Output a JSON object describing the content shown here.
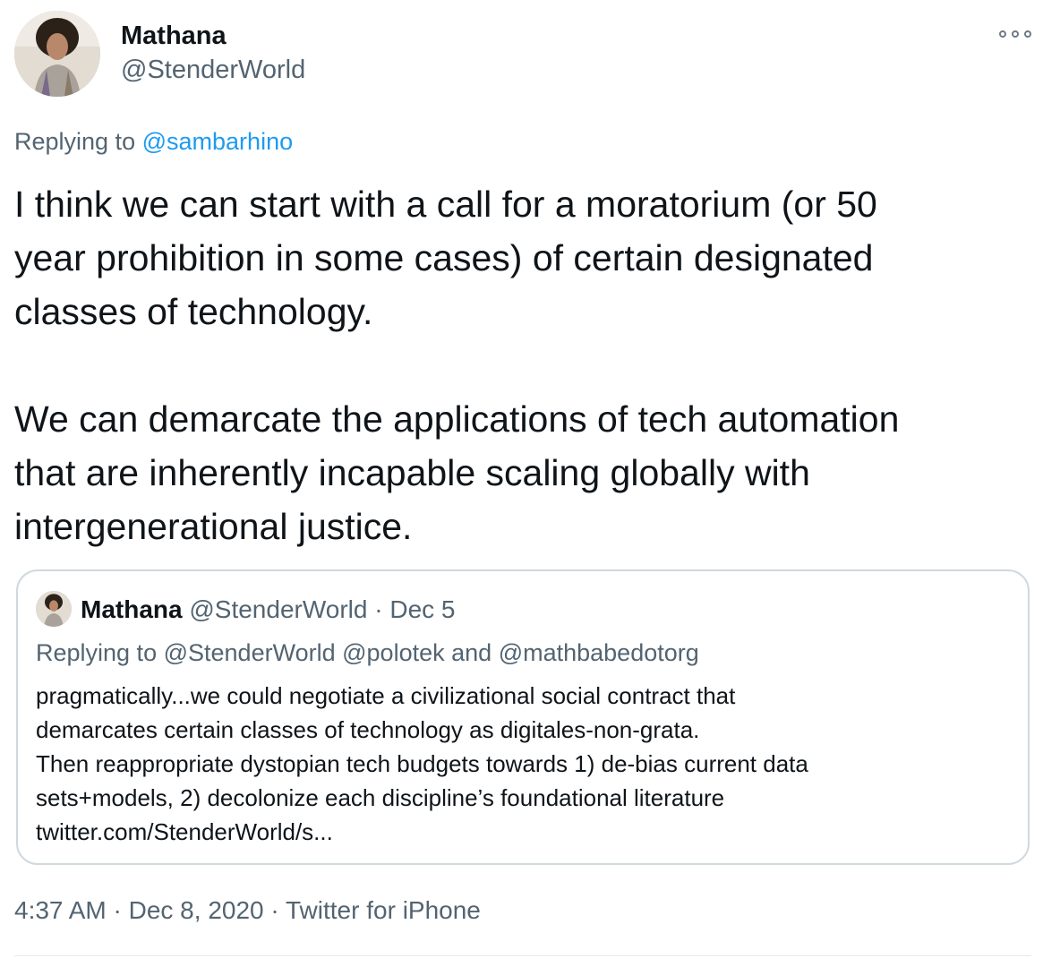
{
  "tweet": {
    "author_name": "Mathana",
    "author_handle": "@StenderWorld",
    "replying_prefix": "Replying to",
    "replying_to": "@sambarhino",
    "paragraph1_lines": [
      "I think we can start with a call for a moratorium (or 50",
      "year prohibition in some cases) of certain designated",
      "classes of technology."
    ],
    "paragraph2_lines": [
      "We can demarcate the applications of tech automation",
      "that are inherently incapable scaling globally with",
      "intergenerational justice."
    ],
    "timestamp": "4:37 AM · Dec 8, 2020",
    "separator": "·",
    "source": "Twitter for iPhone"
  },
  "quoted_tweet": {
    "author_name": "Mathana",
    "author_handle": "@StenderWorld",
    "date": "· Dec 5",
    "replying_prefix": "Replying to",
    "replying_to_1": "@StenderWorld",
    "replying_to_2": "@polotek",
    "replying_and": "and",
    "replying_to_3": "@mathbabedotorg",
    "lines": [
      "pragmatically...we could negotiate a civilizational social contract that",
      "demarcates certain classes of technology as digitales-non-grata.",
      "Then reappropriate dystopian tech budgets towards 1) de-bias current data",
      "sets+models, 2) decolonize each discipline’s foundational literature",
      "twitter.com/StenderWorld/s..."
    ]
  },
  "icons": {
    "more": "more-options-icon"
  },
  "colors": {
    "link": "#1d9bf0",
    "secondary_text": "#536471",
    "primary_text": "#0f1419",
    "border": "#cfd9de"
  }
}
